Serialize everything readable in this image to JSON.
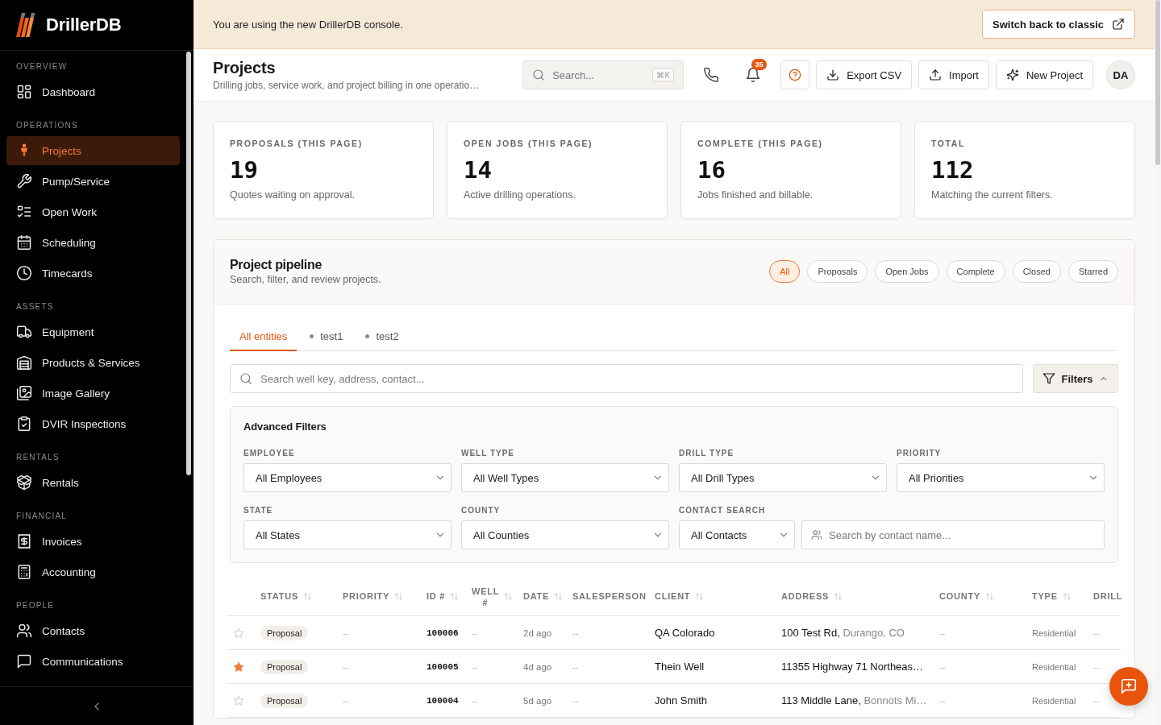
{
  "sidebar": {
    "brand": "DrillerDB",
    "sections": [
      {
        "title": "OVERVIEW",
        "items": [
          {
            "label": "Dashboard",
            "selected": false
          }
        ]
      },
      {
        "title": "OPERATIONS",
        "items": [
          {
            "label": "Projects",
            "selected": true
          },
          {
            "label": "Pump/Service",
            "selected": false
          },
          {
            "label": "Open Work",
            "selected": false
          },
          {
            "label": "Scheduling",
            "selected": false
          },
          {
            "label": "Timecards",
            "selected": false
          }
        ]
      },
      {
        "title": "ASSETS",
        "items": [
          {
            "label": "Equipment",
            "selected": false
          },
          {
            "label": "Products & Services",
            "selected": false
          },
          {
            "label": "Image Gallery",
            "selected": false
          },
          {
            "label": "DVIR Inspections",
            "selected": false
          }
        ]
      },
      {
        "title": "RENTALS",
        "items": [
          {
            "label": "Rentals",
            "selected": false
          }
        ]
      },
      {
        "title": "FINANCIAL",
        "items": [
          {
            "label": "Invoices",
            "selected": false
          },
          {
            "label": "Accounting",
            "selected": false
          }
        ]
      },
      {
        "title": "PEOPLE",
        "items": [
          {
            "label": "Contacts",
            "selected": false
          },
          {
            "label": "Communications",
            "selected": false
          }
        ]
      }
    ]
  },
  "banner": {
    "message": "You are using the new DrillerDB console.",
    "button": "Switch back to classic"
  },
  "header": {
    "title": "Projects",
    "subtitle": "Drilling jobs, service work, and project billing in one operatio…",
    "search": {
      "placeholder": "Search...",
      "shortcut": "⌘K"
    },
    "notification_count": "35",
    "buttons": [
      "Export CSV",
      "Import",
      "New Project"
    ],
    "avatar": "DA"
  },
  "stats": [
    {
      "label": "PROPOSALS (THIS PAGE)",
      "value": "19",
      "description": "Quotes waiting on approval."
    },
    {
      "label": "OPEN JOBS (THIS PAGE)",
      "value": "14",
      "description": "Active drilling operations."
    },
    {
      "label": "COMPLETE (THIS PAGE)",
      "value": "16",
      "description": "Jobs finished and billable."
    },
    {
      "label": "TOTAL",
      "value": "112",
      "description": "Matching the current filters."
    }
  ],
  "pipeline": {
    "title": "Project pipeline",
    "subtitle": "Search, filter, and review projects.",
    "chips": [
      {
        "label": "All",
        "selected": true
      },
      {
        "label": "Proposals",
        "selected": false
      },
      {
        "label": "Open Jobs",
        "selected": false
      },
      {
        "label": "Complete",
        "selected": false
      },
      {
        "label": "Closed",
        "selected": false
      },
      {
        "label": "Starred",
        "selected": false
      }
    ],
    "tabs": [
      {
        "label": "All entities",
        "kind": "all",
        "selected": true
      },
      {
        "label": "test1",
        "kind": "entity",
        "selected": false
      },
      {
        "label": "test2",
        "kind": "entity",
        "selected": false
      }
    ],
    "search": {
      "placeholder": "Search well key, address, contact..."
    },
    "filters_button": {
      "label": "Filters",
      "expanded": true
    },
    "advanced_filters": {
      "title": "Advanced Filters",
      "fields": [
        {
          "label": "EMPLOYEE",
          "kind": "select",
          "value": "All Employees"
        },
        {
          "label": "WELL TYPE",
          "kind": "select",
          "value": "All Well Types"
        },
        {
          "label": "DRILL TYPE",
          "kind": "select",
          "value": "All Drill Types"
        },
        {
          "label": "PRIORITY",
          "kind": "select",
          "value": "All Priorities"
        },
        {
          "label": "STATE",
          "kind": "select",
          "value": "All States"
        },
        {
          "label": "COUNTY",
          "kind": "select",
          "value": "All Counties"
        },
        {
          "label": "CONTACT SEARCH",
          "kind": "contact_search",
          "value": "All Contacts",
          "placeholder": "Search by contact name..."
        }
      ]
    },
    "table": {
      "columns": [
        {
          "label": "STATUS",
          "sortable": true
        },
        {
          "label": "PRIORITY",
          "sortable": true
        },
        {
          "label": "ID #",
          "sortable": true
        },
        {
          "label": "WELL #",
          "sortable": true
        },
        {
          "label": "DATE",
          "sortable": true
        },
        {
          "label": "SALESPERSON",
          "sortable": false
        },
        {
          "label": "CLIENT",
          "sortable": true
        },
        {
          "label": "ADDRESS",
          "sortable": true
        },
        {
          "label": "COUNTY",
          "sortable": true
        },
        {
          "label": "TYPE",
          "sortable": true
        },
        {
          "label": "DRILL",
          "sortable": false
        }
      ],
      "rows": [
        {
          "starred": false,
          "status": "Proposal",
          "priority": "--",
          "id": "100006",
          "well": "--",
          "date": "2d ago",
          "salesperson": "--",
          "client": "QA Colorado",
          "address": {
            "street": "100 Test Rd,",
            "locality": "Durango, CO"
          },
          "county": "--",
          "type": "Residential",
          "drill": "--"
        },
        {
          "starred": true,
          "status": "Proposal",
          "priority": "--",
          "id": "100005",
          "well": "--",
          "date": "4d ago",
          "salesperson": "--",
          "client": "Thein Well",
          "address": {
            "street": "11355 Highway 71 Northeas…"
          },
          "county": "--",
          "type": "Residential",
          "drill": "--"
        },
        {
          "starred": false,
          "status": "Proposal",
          "priority": "--",
          "id": "100004",
          "well": "--",
          "date": "5d ago",
          "salesperson": "--",
          "client": "John Smith",
          "address": {
            "street": "113 Middle Lane,",
            "locality": "Bonnots Mi…"
          },
          "county": "--",
          "type": "Residential",
          "drill": "--"
        }
      ]
    }
  }
}
